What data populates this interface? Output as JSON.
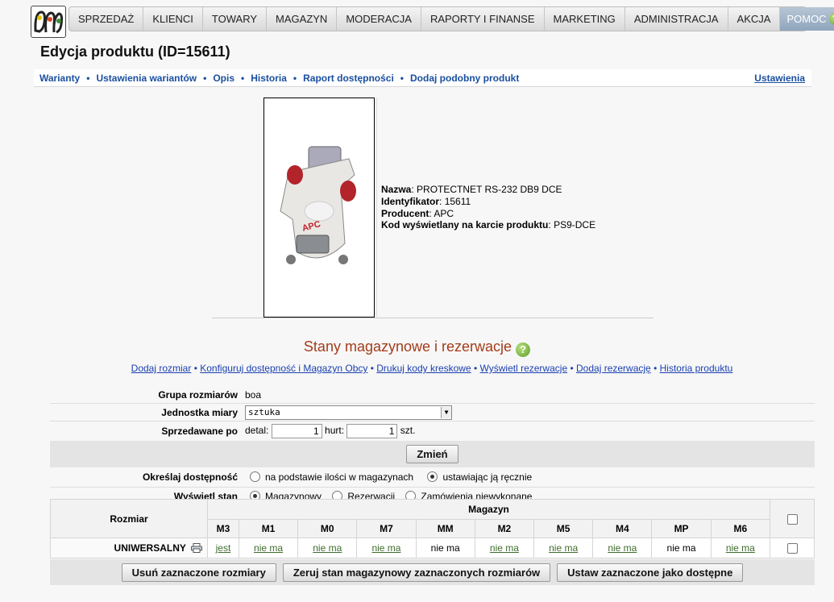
{
  "nav": {
    "items": [
      "SPRZEDAŻ",
      "KLIENCI",
      "TOWARY",
      "MAGAZYN",
      "MODERACJA",
      "RAPORTY I FINANSE",
      "MARKETING",
      "ADMINISTRACJA",
      "AKCJA"
    ],
    "help": "POMOC"
  },
  "page": {
    "title": "Edycja produktu (ID=15611)"
  },
  "subnav": {
    "links": [
      "Warianty",
      "Ustawienia wariantów",
      "Opis",
      "Historia",
      "Raport dostępności",
      "Dodaj podobny produkt"
    ],
    "settings": "Ustawienia"
  },
  "product": {
    "name_label": "Nazwa",
    "name": "PROTECTNET RS-232 DB9 DCE",
    "id_label": "Identyfikator",
    "id": "15611",
    "producer_label": "Producent",
    "producer": "APC",
    "code_label": "Kod wyświetlany na karcie produktu",
    "code": "PS9-DCE",
    "image_brand": "APC"
  },
  "stock": {
    "title": "Stany magazynowe i rezerwacje",
    "actions": [
      "Dodaj rozmiar",
      "Konfiguruj dostępność i Magazyn Obcy",
      "Drukuj kody kreskowe",
      "Wyświetl rezerwacje",
      "Dodaj rezerwację",
      "Historia produktu"
    ],
    "size_group_label": "Grupa rozmiarów",
    "size_group": "boa",
    "unit_label": "Jednostka miary",
    "unit": "sztuka",
    "sold_by_label": "Sprzedawane po",
    "retail_label": "detal:",
    "retail": "1",
    "wholesale_label": "hurt:",
    "wholesale": "1",
    "pcs": "szt.",
    "change_btn": "Zmień",
    "availability_label": "Określaj dostępność",
    "availability_opt1": "na podstawie ilości w magazynach",
    "availability_opt2": "ustawiając ją ręcznie",
    "show_label": "Wyświetl stan",
    "show_opt1": "Magazynowy",
    "show_opt2": "Rezerwacji",
    "show_opt3": "Zamówienia niewykonane"
  },
  "grid": {
    "size_header": "Rozmiar",
    "warehouse_header": "Magazyn",
    "columns": [
      "M3",
      "M1",
      "M0",
      "M7",
      "MM",
      "M2",
      "M5",
      "M4",
      "MP",
      "M6"
    ],
    "row_name": "UNIWERSALNY",
    "cells": [
      {
        "text": "jest",
        "link": true
      },
      {
        "text": "nie ma",
        "link": true
      },
      {
        "text": "nie ma",
        "link": true
      },
      {
        "text": "nie ma",
        "link": true
      },
      {
        "text": "nie ma",
        "link": false
      },
      {
        "text": "nie ma",
        "link": true
      },
      {
        "text": "nie ma",
        "link": true
      },
      {
        "text": "nie ma",
        "link": true
      },
      {
        "text": "nie ma",
        "link": false
      },
      {
        "text": "nie ma",
        "link": true
      }
    ]
  },
  "buttons": {
    "delete": "Usuń zaznaczone rozmiary",
    "reset": "Zeruj stan magazynowy zaznaczonych rozmiarów",
    "available": "Ustaw zaznaczone jako dostępne"
  }
}
